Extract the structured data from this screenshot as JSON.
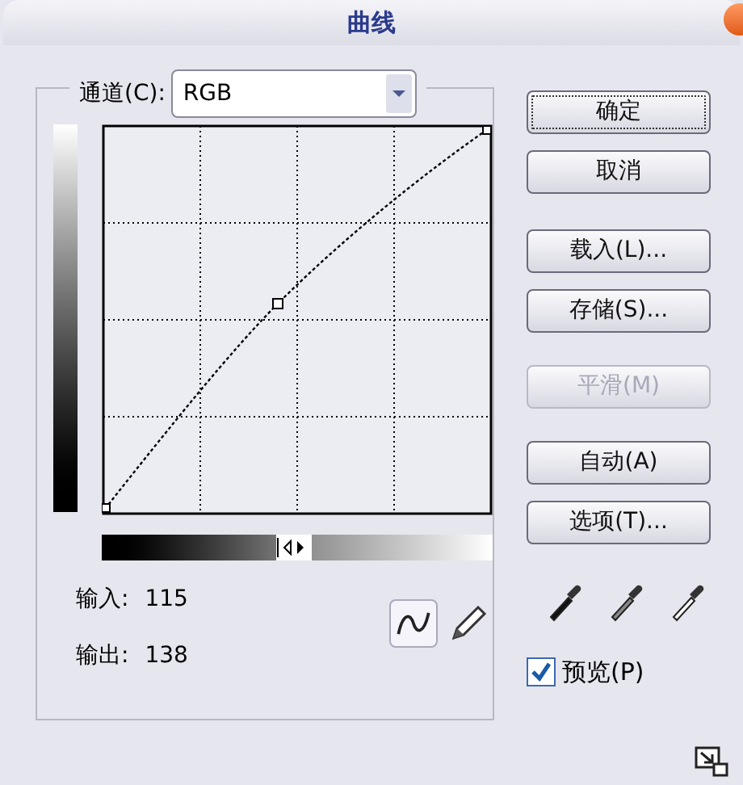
{
  "window": {
    "title": "曲线"
  },
  "channel": {
    "label": "通道(C):",
    "value": "RGB"
  },
  "readouts": [
    {
      "label": "输入:",
      "value": "115"
    },
    {
      "label": "输出:",
      "value": "138"
    }
  ],
  "tools": [
    {
      "kind": "curve",
      "selected": true
    },
    {
      "kind": "pencil",
      "selected": false
    }
  ],
  "buttons": [
    {
      "label": "确定",
      "default": true,
      "disabled": false
    },
    {
      "label": "取消",
      "default": false,
      "disabled": false
    },
    {
      "label": "载入(L)...",
      "default": false,
      "disabled": false
    },
    {
      "label": "存储(S)...",
      "default": false,
      "disabled": false
    },
    {
      "label": "平滑(M)",
      "default": false,
      "disabled": true
    },
    {
      "label": "自动(A)",
      "default": false,
      "disabled": false
    },
    {
      "label": "选项(T)...",
      "default": false,
      "disabled": false
    }
  ],
  "preview": {
    "label": "预览(P)",
    "checked": true
  }
}
